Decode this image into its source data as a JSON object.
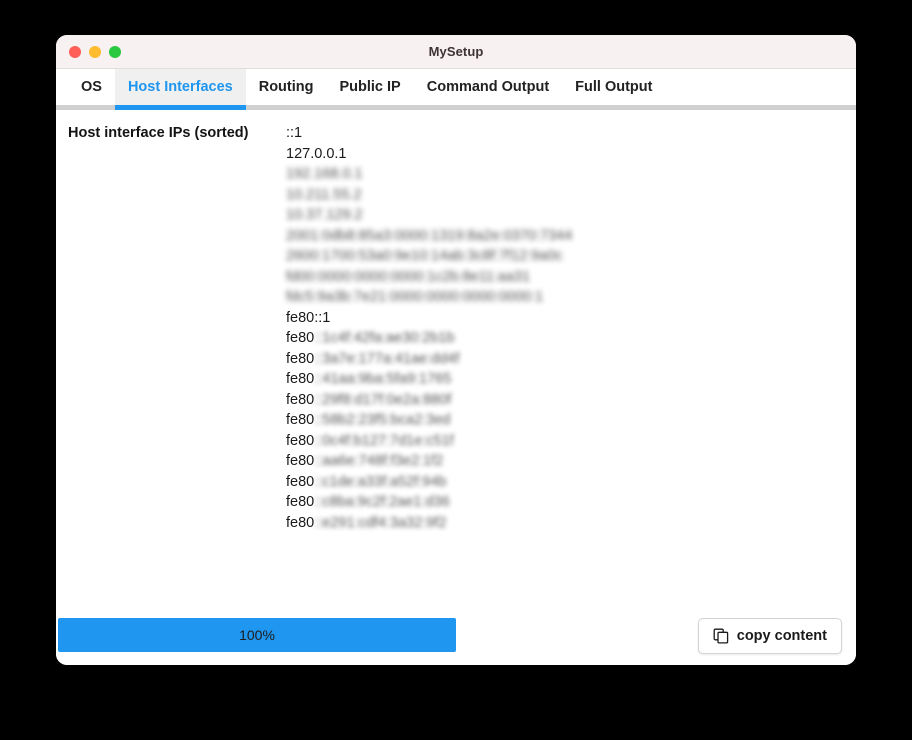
{
  "window": {
    "title": "MySetup",
    "controls": {
      "close": "close",
      "minimize": "minimize",
      "maximize": "maximize"
    }
  },
  "tabs": [
    {
      "label": "OS",
      "active": false
    },
    {
      "label": "Host Interfaces",
      "active": true
    },
    {
      "label": "Routing",
      "active": false
    },
    {
      "label": "Public IP",
      "active": false
    },
    {
      "label": "Command Output",
      "active": false
    },
    {
      "label": "Full Output",
      "active": false
    }
  ],
  "main": {
    "field_label": "Host interface IPs (sorted)",
    "ip_list": [
      {
        "text": "::1",
        "redacted": false
      },
      {
        "text": "127.0.0.1",
        "redacted": false
      },
      {
        "text": "192.168.0.1",
        "redacted": true
      },
      {
        "text": "10.211.55.2",
        "redacted": true
      },
      {
        "text": "10.37.129.2",
        "redacted": true
      },
      {
        "text": "2001:0db8:85a3:0000:1319:8a2e:0370:7344",
        "redacted": true
      },
      {
        "text": "2600:1700:53a0:9e10:14ab:3c8f:7f12:9a0c",
        "redacted": true
      },
      {
        "text": "fd00:0000:0000:0000:1c2b:8e11:aa31",
        "redacted": true
      },
      {
        "text": "fdc5:9a3b:7e21:0000:0000:0000:0000:1",
        "redacted": true
      },
      {
        "text": "fe80::1",
        "redacted": false
      },
      {
        "visible_prefix": "fe80",
        "hidden_suffix": "::1c4f:42fa:ae30:2b1b",
        "redacted": true
      },
      {
        "visible_prefix": "fe80",
        "hidden_suffix": "::3a7e:177a:41ae:dd4f",
        "redacted": true
      },
      {
        "visible_prefix": "fe80",
        "hidden_suffix": "::41aa:9ba:5fa9:1765",
        "redacted": true
      },
      {
        "visible_prefix": "fe80",
        "hidden_suffix": "::29f8:d17f:0e2a:880f",
        "redacted": true
      },
      {
        "visible_prefix": "fe80",
        "hidden_suffix": "::58b2:23f5:bca2:3ed",
        "redacted": true
      },
      {
        "visible_prefix": "fe80",
        "hidden_suffix": "::0c4f:b127:7d1e:c51f",
        "redacted": true
      },
      {
        "visible_prefix": "fe80",
        "hidden_suffix": "::aa6e:748f:f3e2:1f2",
        "redacted": true
      },
      {
        "visible_prefix": "fe80",
        "hidden_suffix": "::c1de:a33f:a52f:94b",
        "redacted": true
      },
      {
        "visible_prefix": "fe80",
        "hidden_suffix": "::c8ba:9c2f:2ae1:d36",
        "redacted": true
      },
      {
        "visible_prefix": "fe80",
        "hidden_suffix": "::e291:cdf4:3a32:9f2",
        "redacted": true
      }
    ]
  },
  "footer": {
    "progress": {
      "value": 100,
      "label": "100%"
    },
    "copy_button": {
      "label": "copy content",
      "icon": "copy-icon"
    }
  },
  "colors": {
    "accent": "#1f96ef",
    "titlebar_bg": "#f7f1f1",
    "active_tab_bg": "#f0f0f0",
    "traffic_close": "#ff5f57",
    "traffic_min": "#febc2e",
    "traffic_max": "#28c840",
    "page_bg": "#000000",
    "window_bg": "#ffffff"
  }
}
